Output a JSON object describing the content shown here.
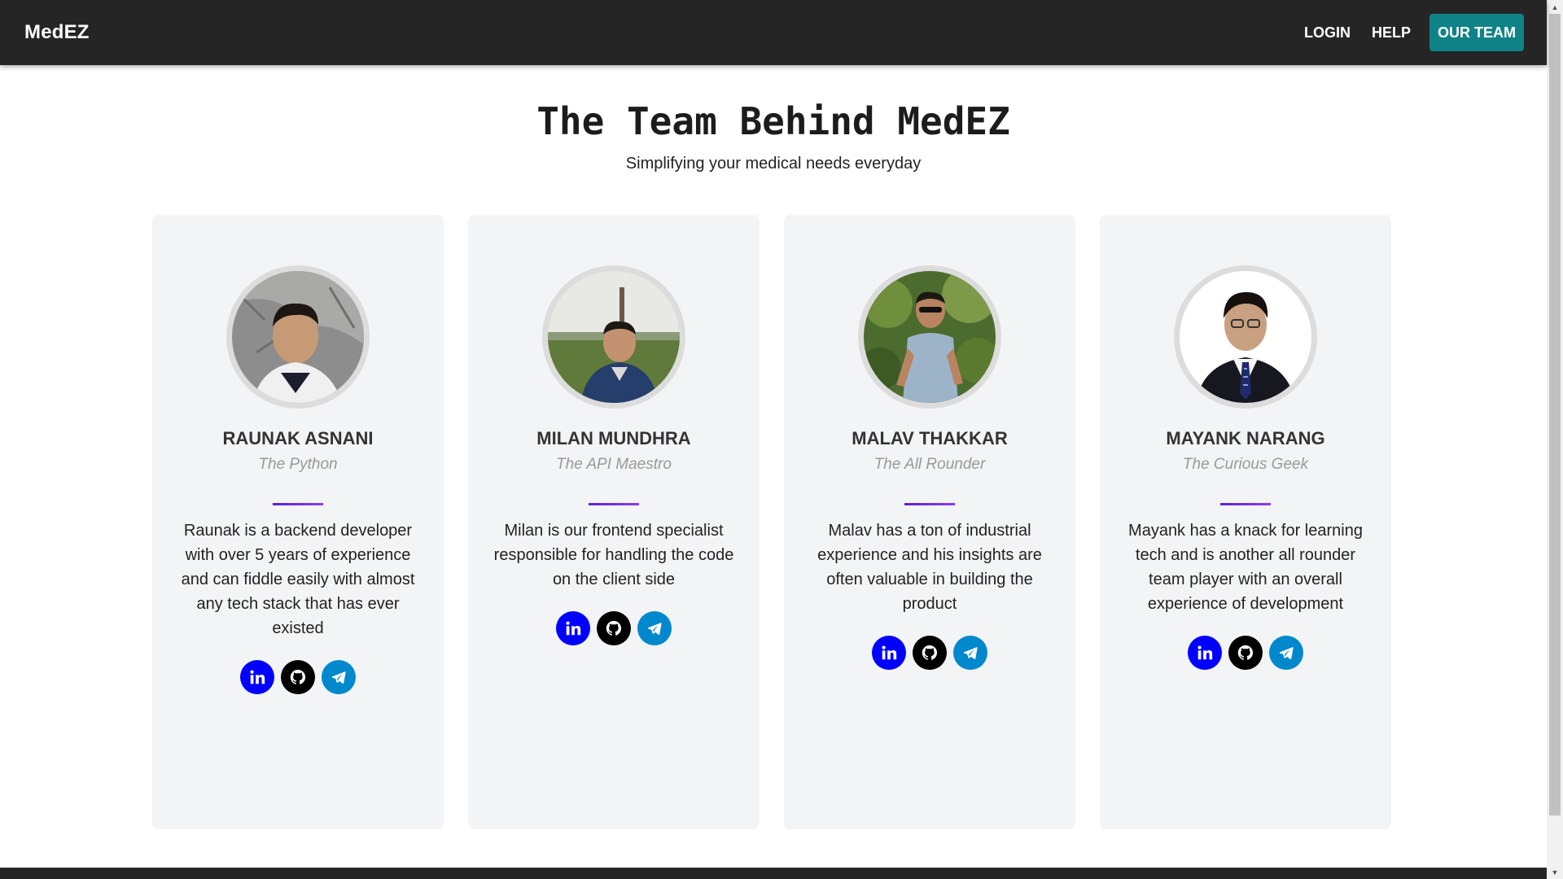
{
  "nav": {
    "brand": "MedEZ",
    "links": [
      {
        "label": "LOGIN"
      },
      {
        "label": "HELP"
      },
      {
        "label": "OUR TEAM",
        "active": true
      }
    ]
  },
  "header": {
    "title": "The Team Behind MedEZ",
    "subtitle": "Simplifying your medical needs everyday"
  },
  "team": [
    {
      "name": "RAUNAK ASNANI",
      "role": "The Python",
      "bio": "Raunak is a backend developer with over 5 years of experience and can fiddle easily with almost any tech stack that has ever existed",
      "socials": [
        "linkedin-icon",
        "github-icon",
        "telegram-icon"
      ]
    },
    {
      "name": "MILAN MUNDHRA",
      "role": "The API Maestro",
      "bio": "Milan is our frontend specialist responsible for handling the code on the client side",
      "socials": [
        "linkedin-icon",
        "github-icon",
        "telegram-icon"
      ]
    },
    {
      "name": "MALAV THAKKAR",
      "role": "The All Rounder",
      "bio": "Malav has a ton of industrial experience and his insights are often valuable in building the product",
      "socials": [
        "linkedin-icon",
        "github-icon",
        "telegram-icon"
      ]
    },
    {
      "name": "MAYANK NARANG",
      "role": "The Curious Geek",
      "bio": "Mayank has a knack for learning tech and is another all rounder team player with an overall experience of development",
      "socials": [
        "linkedin-icon",
        "github-icon",
        "telegram-icon"
      ]
    }
  ],
  "colors": {
    "navbar": "#252525",
    "active_link": "#0f8387",
    "card_bg": "#f3f4f6",
    "divider": "#6a2be0",
    "linkedin": "#0000ff",
    "github": "#000000",
    "telegram": "#0088cc"
  }
}
